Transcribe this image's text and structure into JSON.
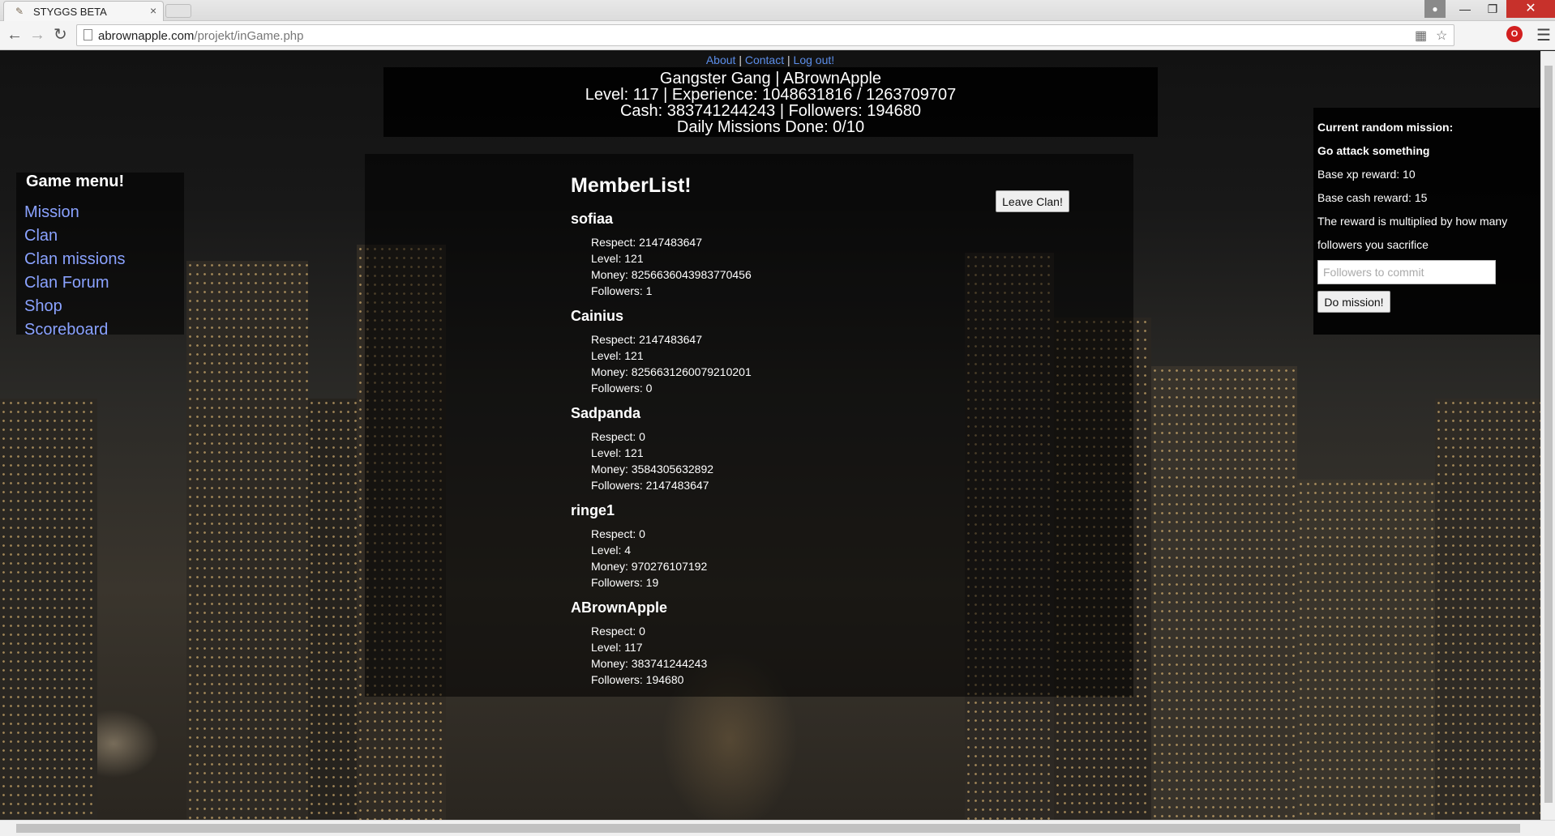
{
  "browser": {
    "tab_title": "STYGGS BETA",
    "tab_close": "×",
    "url_host": "abrownapple.com",
    "url_path": "/projekt/inGame.php",
    "icons": [
      "back-icon",
      "forward-icon",
      "reload-icon",
      "page-icon",
      "translate-icon",
      "star-icon",
      "extension-icon",
      "menu-icon",
      "minimize-icon",
      "maximize-icon",
      "close-icon",
      "user-icon"
    ]
  },
  "header": {
    "links": {
      "about": "About",
      "contact": "Contact",
      "logout": "Log out!",
      "sep": "|"
    },
    "line1": "Gangster Gang | ABrownApple",
    "line2": "Level: 117 | Experience: 1048631816 / 1263709707",
    "line3": "Cash: 383741244243 | Followers: 194680",
    "line4": "Daily Missions Done: 0/10"
  },
  "sidebar": {
    "title": "Game menu!",
    "items": [
      {
        "label": "Mission"
      },
      {
        "label": "Clan"
      },
      {
        "label": "Clan missions"
      },
      {
        "label": "Clan Forum"
      },
      {
        "label": "Shop"
      },
      {
        "label": "Scoreboard"
      }
    ]
  },
  "memberlist": {
    "title": "MemberList!",
    "leave_label": "Leave Clan!",
    "members": [
      {
        "name": "sofiaa",
        "respect": "Respect: 2147483647",
        "level": "Level: 121",
        "money": "Money: 8256636043983770456",
        "followers": "Followers: 1"
      },
      {
        "name": "Cainius",
        "respect": "Respect: 2147483647",
        "level": "Level: 121",
        "money": "Money: 8256631260079210201",
        "followers": "Followers: 0"
      },
      {
        "name": "Sadpanda",
        "respect": "Respect: 0",
        "level": "Level: 121",
        "money": "Money: 3584305632892",
        "followers": "Followers: 2147483647"
      },
      {
        "name": "ringe1",
        "respect": "Respect: 0",
        "level": "Level: 4",
        "money": "Money: 970276107192",
        "followers": "Followers: 19"
      },
      {
        "name": "ABrownApple",
        "respect": "Respect: 0",
        "level": "Level: 117",
        "money": "Money: 383741244243",
        "followers": "Followers: 194680"
      }
    ]
  },
  "mission": {
    "heading": "Current random mission:",
    "name": "Go attack something",
    "xp": "Base xp reward: 10",
    "cash": "Base cash reward: 15",
    "desc1": "The reward is multiplied by how many",
    "desc2": "followers you sacrifice",
    "input_placeholder": "Followers to commit",
    "button_label": "Do mission!"
  },
  "colors": {
    "link": "#5b8de8",
    "menu_link": "#8aa2ff",
    "close_button": "#c7312b"
  }
}
